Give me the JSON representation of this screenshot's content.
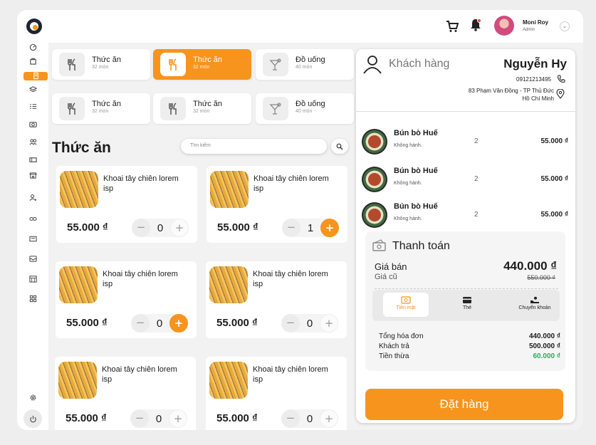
{
  "header": {
    "user_name": "Moni Roy",
    "user_role": "Admin"
  },
  "categories": [
    {
      "title": "Thức ăn",
      "subtitle": "32 món",
      "icon": "cutlery-icon",
      "active": false
    },
    {
      "title": "Thức ăn",
      "subtitle": "32 món",
      "icon": "cutlery-icon",
      "active": true
    },
    {
      "title": "Đồ uống",
      "subtitle": "40 món",
      "icon": "cocktail-icon",
      "active": false
    },
    {
      "title": "Thức ăn",
      "subtitle": "32 món",
      "icon": "cutlery-icon",
      "active": false
    },
    {
      "title": "Thức ăn",
      "subtitle": "32 món",
      "icon": "cutlery-icon",
      "active": false
    },
    {
      "title": "Đồ uống",
      "subtitle": "40 món",
      "icon": "cocktail-icon",
      "active": false
    }
  ],
  "section": {
    "title": "Thức ăn",
    "search_placeholder": "Tìm kiếm"
  },
  "products": [
    {
      "name": "Khoai tây chiên lorem isp",
      "price": "55.000 ₫",
      "qty": "0",
      "plus_active": false
    },
    {
      "name": "Khoai tây chiên lorem isp",
      "price": "55.000 ₫",
      "qty": "1",
      "plus_active": true
    },
    {
      "name": "Khoai tây chiên lorem isp",
      "price": "55.000 ₫",
      "qty": "0",
      "plus_active": true
    },
    {
      "name": "Khoai tây chiên lorem isp",
      "price": "55.000 ₫",
      "qty": "0",
      "plus_active": false
    },
    {
      "name": "Khoai tây chiên lorem isp",
      "price": "55.000 ₫",
      "qty": "0",
      "plus_active": false
    },
    {
      "name": "Khoai tây chiên lorem isp",
      "price": "55.000 ₫",
      "qty": "0",
      "plus_active": false
    }
  ],
  "customer": {
    "label": "Khách hàng",
    "name": "Nguyễn Hy",
    "phone": "09121213495",
    "address_line1": "83 Phạm Văn Đồng - TP Thủ Đức",
    "address_line2": "Hồ Chí Minh"
  },
  "order_items": [
    {
      "name": "Bún bò Huế",
      "note": "Không hành.",
      "qty": "2",
      "price": "55.000 ₫"
    },
    {
      "name": "Bún bò Huế",
      "note": "Không hành.",
      "qty": "2",
      "price": "55.000 ₫"
    },
    {
      "name": "Bún bò Huế",
      "note": "Không hành.",
      "qty": "2",
      "price": "55.000 ₫"
    }
  ],
  "payment": {
    "title": "Thanh toán",
    "price_label": "Giá bán",
    "price_value": "440.000 ₫",
    "old_label": "Giá cũ",
    "old_value": "550.000 ₫",
    "methods": [
      {
        "label": "Tiền mặt",
        "icon": "cash-icon",
        "active": true
      },
      {
        "label": "Thẻ",
        "icon": "card-icon",
        "active": false
      },
      {
        "label": "Chuyển khoản",
        "icon": "transfer-icon",
        "active": false
      }
    ],
    "total_label": "Tổng hóa đơn",
    "total_value": "440.000 ₫",
    "paid_label": "Khách trả",
    "paid_value": "500.000 ₫",
    "change_label": "Tiền thừa",
    "change_value": "60.000 ₫"
  },
  "order_button": "Đặt hàng",
  "colors": {
    "accent": "#f7941d",
    "green": "#27ae60"
  }
}
